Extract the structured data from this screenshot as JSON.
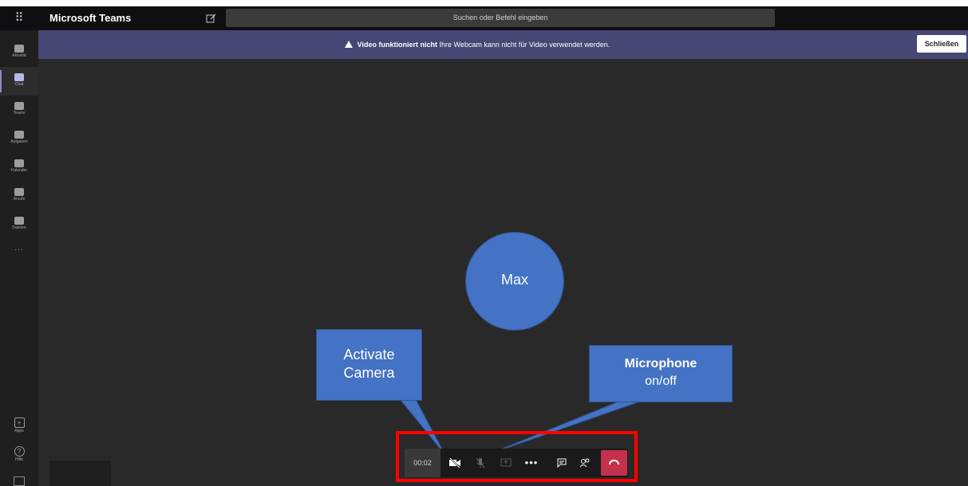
{
  "titlebar": {
    "app_title": "Microsoft Teams",
    "search_placeholder": "Suchen oder Befehl eingeben"
  },
  "rail": {
    "items": [
      {
        "label": "Aktivität",
        "icon": "bell-icon"
      },
      {
        "label": "Chat",
        "icon": "chat-icon",
        "active": true
      },
      {
        "label": "Teams",
        "icon": "teams-icon"
      },
      {
        "label": "Aufgaben",
        "icon": "tasks-icon"
      },
      {
        "label": "Kalender",
        "icon": "calendar-icon"
      },
      {
        "label": "Anrufe",
        "icon": "phone-icon"
      },
      {
        "label": "Dateien",
        "icon": "files-icon"
      }
    ],
    "more": "...",
    "bottom_items": [
      {
        "label": "Apps",
        "icon": "apps-icon"
      },
      {
        "label": "Hilfe",
        "icon": "help-icon"
      }
    ]
  },
  "banner": {
    "title": "Video funktioniert nicht",
    "message": "Ihre Webcam kann nicht für Video verwendet werden.",
    "close_label": "Schließen",
    "color": "#464775"
  },
  "avatar": {
    "name": "Max",
    "color": "#4472c4"
  },
  "callouts": {
    "camera": {
      "line1": "Activate",
      "line2": "Camera"
    },
    "microphone": {
      "bold": "Microphone",
      "rest": "on/off"
    }
  },
  "controls": {
    "timer": "00:02",
    "buttons": [
      "video-off-icon",
      "microphone-icon",
      "share-screen-icon",
      "more-icon",
      "chat-icon",
      "participants-icon",
      "hang-up-icon"
    ],
    "more_label": "•••",
    "hangup_color": "#c4314b"
  },
  "highlight_color": "#ff0000"
}
